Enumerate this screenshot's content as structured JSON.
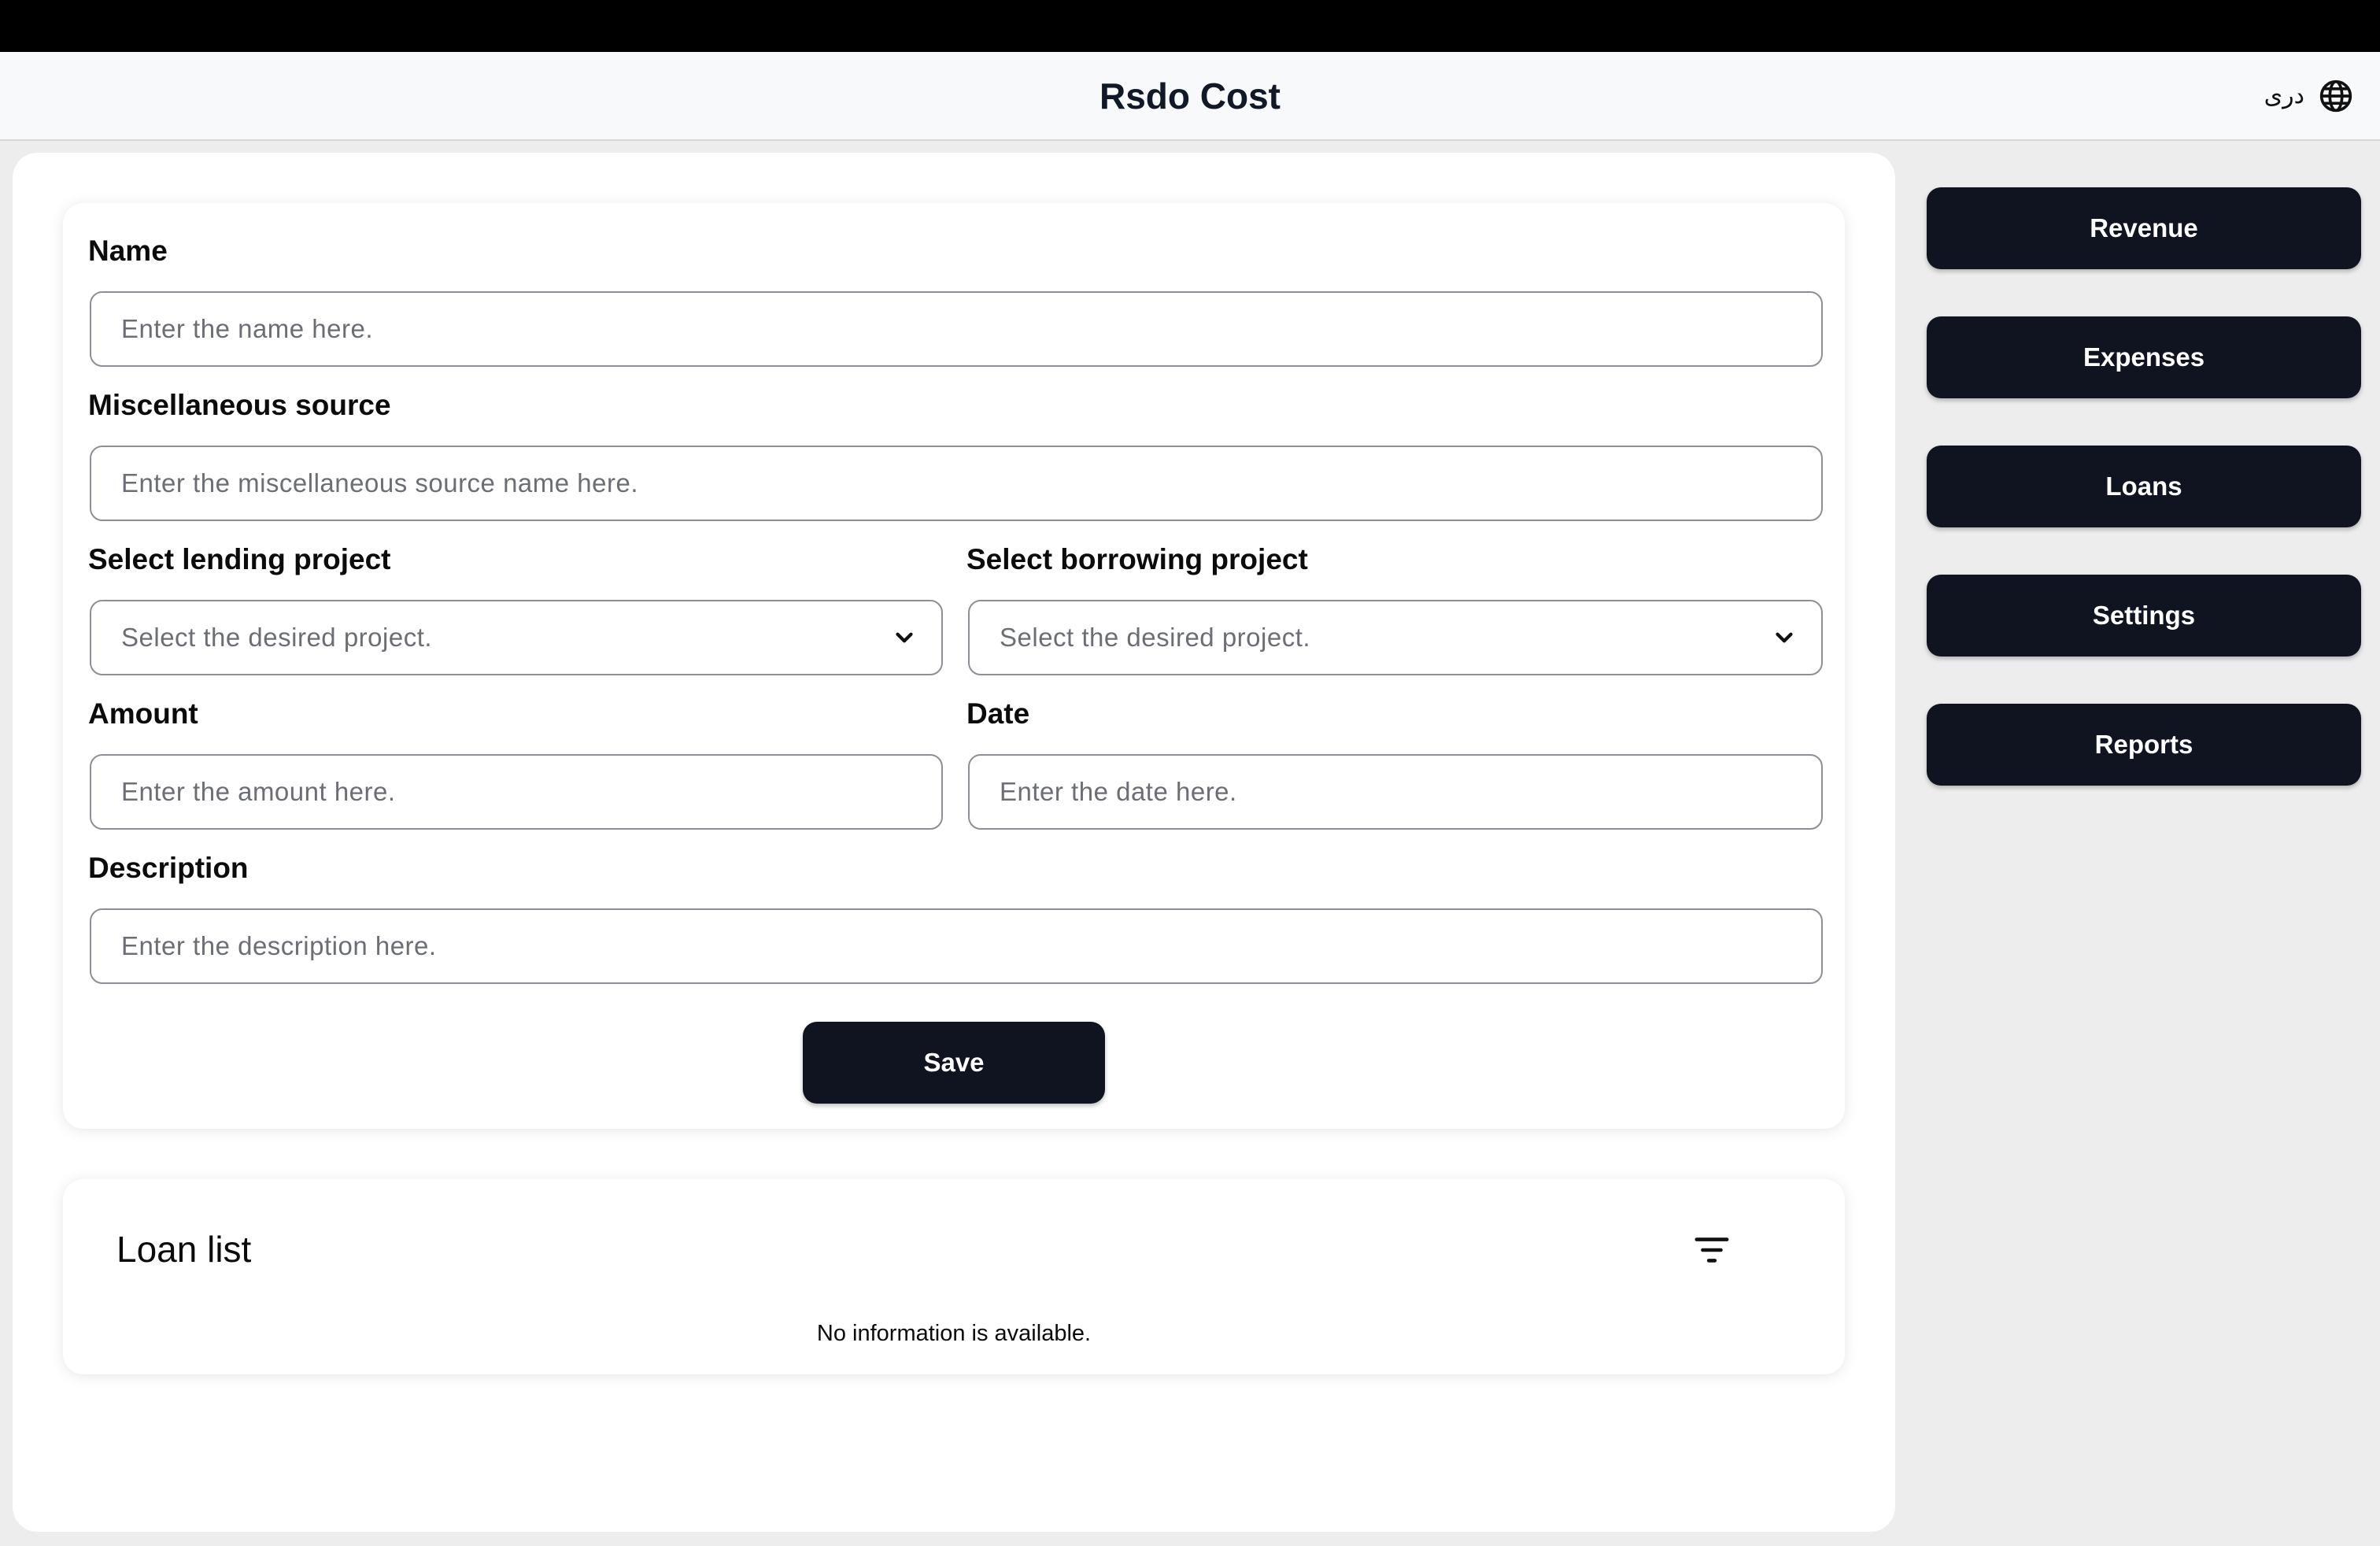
{
  "app": {
    "title": "Rsdo Cost",
    "language_label": "دری"
  },
  "form": {
    "name_label": "Name",
    "name_placeholder": "Enter the name here.",
    "misc_label": "Miscellaneous source",
    "misc_placeholder": "Enter the miscellaneous source name here.",
    "lending_label": "Select lending project",
    "lending_value": "Select the desired project.",
    "borrowing_label": "Select borrowing project",
    "borrowing_value": "Select the desired project.",
    "amount_label": "Amount",
    "amount_placeholder": "Enter the amount here.",
    "date_label": "Date",
    "date_placeholder": "Enter the date here.",
    "description_label": "Description",
    "description_placeholder": "Enter the description here.",
    "save_label": "Save"
  },
  "loan_list": {
    "title": "Loan list",
    "empty_message": "No information is available.",
    "filter_icon": "filter-icon"
  },
  "nav": {
    "items": [
      {
        "label": "Revenue"
      },
      {
        "label": "Expenses"
      },
      {
        "label": "Loans"
      },
      {
        "label": "Settings"
      },
      {
        "label": "Reports"
      }
    ]
  },
  "colors": {
    "primary": "#0f1420",
    "background": "#ededed",
    "card": "#ffffff",
    "header": "#f8f9fb"
  }
}
